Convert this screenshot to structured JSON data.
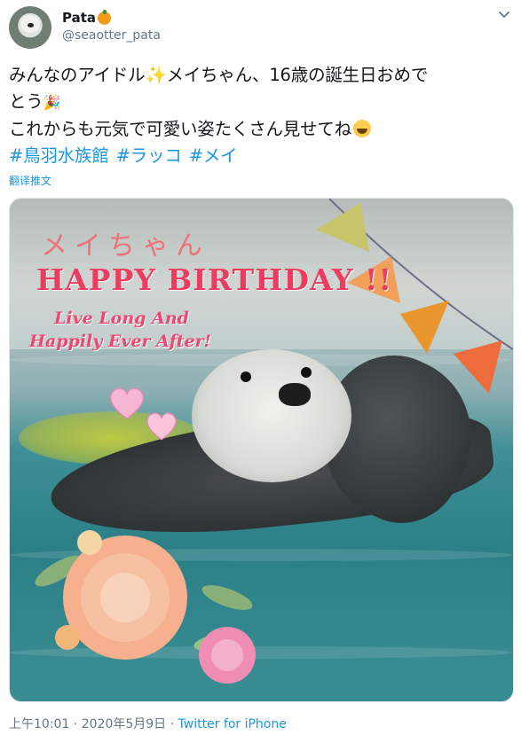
{
  "user": {
    "name": "Pata",
    "handle": "@seaotter_pata",
    "name_emoji": "orange-icon"
  },
  "tweet": {
    "line1": "みんなのアイドル",
    "line1_b": "メイちゃん、16歳の誕生日おめで",
    "line2": "とう",
    "line3": "これからも元気で可愛い姿たくさん見せてね",
    "hashtags": [
      "#鳥羽水族館",
      "#ラッコ",
      "#メイ"
    ],
    "translate_label": "翻译推文"
  },
  "photo": {
    "title": "メイちゃん",
    "headline": "HAPPY BIRTHDAY !!",
    "line_a": "Live Long And",
    "line_b": "Happily Ever After!"
  },
  "meta": {
    "time": "上午10:01",
    "sep1": " · ",
    "date": "2020年5月9日",
    "sep2": " · ",
    "source": "Twitter for iPhone"
  },
  "colors": {
    "link": "#1b95e0",
    "secondary": "#657786",
    "headline": "#ee3c5f"
  }
}
